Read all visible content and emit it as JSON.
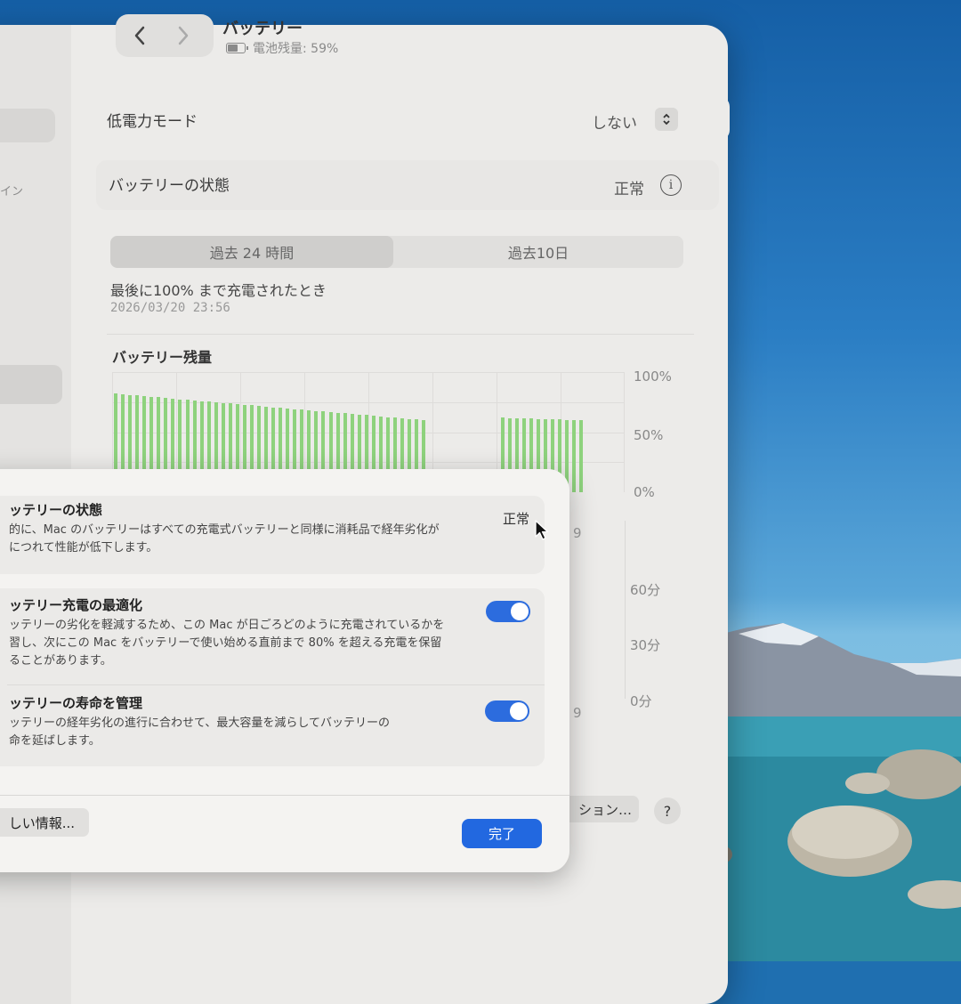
{
  "window": {
    "title": "バッテリー",
    "subtitle": "電池残量: 59%",
    "sidebar_fragment": "イン",
    "low_power": {
      "label": "低電力モード",
      "value": "しない"
    },
    "health": {
      "label": "バッテリーの状態",
      "value": "正常"
    },
    "tabs": [
      "過去 24 時間",
      "過去10日"
    ],
    "last_full_charge": {
      "label": "最後に100% まで充電されたとき",
      "date": "2026/03/20 23:56"
    },
    "chart_title": "バッテリー残量",
    "hidden_label_1": "9",
    "hidden_label_2": "9",
    "options_label": "ション…",
    "help_label": "?"
  },
  "chart_data": [
    {
      "type": "bar",
      "title": "バッテリー残量",
      "y_tick_labels": [
        "100%",
        "50%",
        "0%"
      ],
      "ylim": [
        0,
        100
      ],
      "segments": [
        {
          "start_index": 0,
          "count": 44,
          "level_percent": [
            82,
            60
          ]
        },
        {
          "start_index": 54,
          "count": 12,
          "level_percent": [
            62,
            60
          ]
        }
      ],
      "colors": {
        "bar": "#8ed27d"
      }
    },
    {
      "type": "bar",
      "y_tick_labels": [
        "60分",
        "30分",
        "0分"
      ],
      "ylim": [
        0,
        60
      ]
    }
  ],
  "sheet": {
    "cards": [
      {
        "title": "ッテリーの状態",
        "status": "正常",
        "desc": [
          "的に、Mac のバッテリーはすべての充電式バッテリーと同様に消耗品で経年劣化が",
          "につれて性能が低下します。"
        ]
      },
      {
        "title": "ッテリー充電の最適化",
        "toggle": true,
        "desc": [
          "ッテリーの劣化を軽減するため、この Mac が日ごろどのように充電されているかを",
          "習し、次にこの Mac をバッテリーで使い始める直前まで 80% を超える充電を保留",
          "ることがあります。"
        ]
      },
      {
        "title": "ッテリーの寿命を管理",
        "toggle": true,
        "desc": [
          "ッテリーの経年劣化の進行に合わせて、最大容量を減らしてバッテリーの",
          "命を延ばします。"
        ]
      }
    ],
    "more_info_label": "しい情報...",
    "done_label": "完了",
    "accent_color": "#2268e0"
  }
}
